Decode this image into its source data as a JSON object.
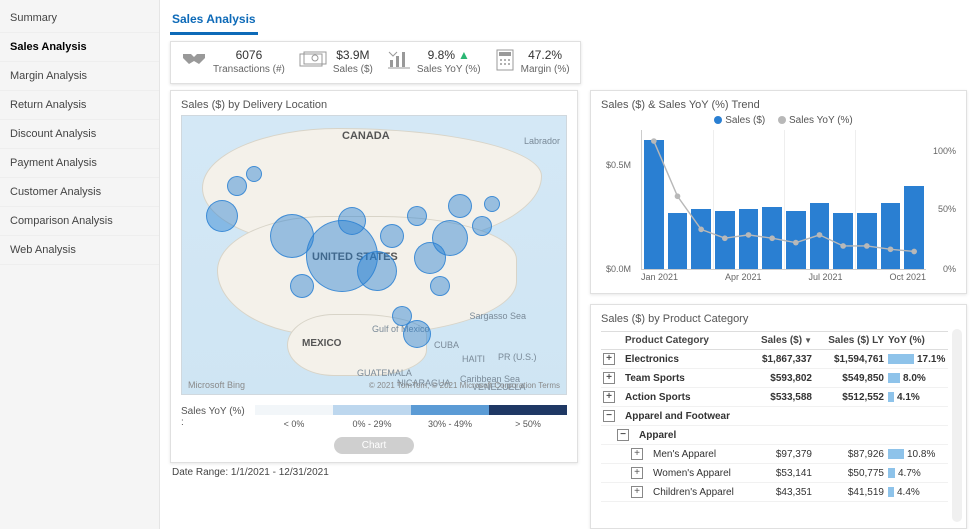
{
  "sidebar": {
    "items": [
      {
        "label": "Summary"
      },
      {
        "label": "Sales Analysis",
        "active": true
      },
      {
        "label": "Margin Analysis"
      },
      {
        "label": "Return Analysis"
      },
      {
        "label": "Discount Analysis"
      },
      {
        "label": "Payment Analysis"
      },
      {
        "label": "Customer Analysis"
      },
      {
        "label": "Comparison Analysis"
      },
      {
        "label": "Web Analysis"
      }
    ]
  },
  "header": {
    "tab_title": "Sales Analysis"
  },
  "kpis": [
    {
      "icon": "handshake",
      "value": "6076",
      "label": "Transactions (#)"
    },
    {
      "icon": "cash",
      "value": "$3.9M",
      "label": "Sales ($)"
    },
    {
      "icon": "barchart",
      "value": "9.8%",
      "trend": "up",
      "label": "Sales YoY (%)"
    },
    {
      "icon": "calculator",
      "value": "47.2%",
      "label": "Margin (%)"
    }
  ],
  "map": {
    "title": "Sales ($) by Delivery Location",
    "country_labels": [
      "CANADA",
      "UNITED STATES",
      "MEXICO"
    ],
    "sea_labels": [
      "Labrador",
      "Sargasso Sea",
      "Gulf of Mexico",
      "CUBA",
      "HAITI",
      "PR (U.S.)",
      "GUATEMALA",
      "NICARAGUA",
      "Caribbean Sea",
      "VENEZUELA"
    ],
    "attribution_left": "Microsoft Bing",
    "attribution_right": "© 2021 TomTom, © 2021 Microsoft Corporation   Terms",
    "legend_title": "Sales YoY (%) :",
    "legend_bins": [
      "< 0%",
      "0% - 29%",
      "30% - 49%",
      "> 50%"
    ],
    "chart_button": "Chart",
    "bubbles": [
      {
        "x": 40,
        "y": 100,
        "r": 16
      },
      {
        "x": 55,
        "y": 70,
        "r": 10
      },
      {
        "x": 72,
        "y": 58,
        "r": 8
      },
      {
        "x": 110,
        "y": 120,
        "r": 22
      },
      {
        "x": 160,
        "y": 140,
        "r": 36
      },
      {
        "x": 170,
        "y": 105,
        "r": 14
      },
      {
        "x": 195,
        "y": 155,
        "r": 20
      },
      {
        "x": 210,
        "y": 120,
        "r": 12
      },
      {
        "x": 235,
        "y": 100,
        "r": 10
      },
      {
        "x": 248,
        "y": 142,
        "r": 16
      },
      {
        "x": 258,
        "y": 170,
        "r": 10
      },
      {
        "x": 268,
        "y": 122,
        "r": 18
      },
      {
        "x": 278,
        "y": 90,
        "r": 12
      },
      {
        "x": 300,
        "y": 110,
        "r": 10
      },
      {
        "x": 310,
        "y": 88,
        "r": 8
      },
      {
        "x": 220,
        "y": 200,
        "r": 10
      },
      {
        "x": 235,
        "y": 218,
        "r": 14
      },
      {
        "x": 120,
        "y": 170,
        "r": 12
      }
    ]
  },
  "date_range_label": "Date Range: 1/1/2021 - 12/31/2021",
  "trend": {
    "title": "Sales ($) & Sales YoY (%) Trend",
    "legend": {
      "sales": "Sales ($)",
      "yoy": "Sales YoY (%)"
    },
    "axis_left": [
      "$0.5M",
      "$0.0M"
    ],
    "axis_right": [
      "100%",
      "50%",
      "0%"
    ],
    "axis_x": [
      "Jan 2021",
      "Apr 2021",
      "Jul 2021",
      "Oct 2021"
    ]
  },
  "chart_data": {
    "type": "combo",
    "title": "Sales ($) & Sales YoY (%) Trend",
    "x": [
      "Jan 2021",
      "Feb 2021",
      "Mar 2021",
      "Apr 2021",
      "May 2021",
      "Jun 2021",
      "Jul 2021",
      "Aug 2021",
      "Sep 2021",
      "Oct 2021",
      "Nov 2021",
      "Dec 2021"
    ],
    "series": [
      {
        "name": "Sales ($)",
        "kind": "bar",
        "y_axis": "left",
        "unit": "$",
        "values": [
          650000,
          280000,
          300000,
          290000,
          300000,
          310000,
          290000,
          330000,
          280000,
          280000,
          330000,
          420000
        ]
      },
      {
        "name": "Sales YoY (%)",
        "kind": "line",
        "y_axis": "right",
        "unit": "%",
        "values": [
          110,
          60,
          30,
          22,
          25,
          22,
          18,
          25,
          15,
          15,
          12,
          10
        ]
      }
    ],
    "y_axis_left": {
      "label": "Sales ($)",
      "min": 0,
      "max": 700000,
      "ticks": [
        0,
        500000
      ]
    },
    "y_axis_right": {
      "label": "Sales YoY (%)",
      "min": 0,
      "max": 120,
      "ticks": [
        0,
        50,
        100
      ]
    }
  },
  "table": {
    "title": "Sales ($) by Product Category",
    "columns": [
      "Product Category",
      "Sales ($)",
      "Sales ($) LY",
      "YoY (%)"
    ],
    "rows": [
      {
        "exp": "+",
        "indent": 0,
        "label": "Electronics",
        "sales": "$1,867,337",
        "ly": "$1,594,761",
        "yoy": "17.1%",
        "yoy_w": 26,
        "bold": true
      },
      {
        "exp": "+",
        "indent": 0,
        "label": "Team Sports",
        "sales": "$593,802",
        "ly": "$549,850",
        "yoy": "8.0%",
        "yoy_w": 12,
        "bold": true
      },
      {
        "exp": "+",
        "indent": 0,
        "label": "Action Sports",
        "sales": "$533,588",
        "ly": "$512,552",
        "yoy": "4.1%",
        "yoy_w": 6,
        "bold": true
      },
      {
        "exp": "−",
        "indent": 0,
        "label": "Apparel and Footwear",
        "bold": true
      },
      {
        "exp": "−",
        "indent": 1,
        "label": "Apparel",
        "bold": true
      },
      {
        "exp": "+",
        "indent": 2,
        "label": "Men's Apparel",
        "sales": "$97,379",
        "ly": "$87,926",
        "yoy": "10.8%",
        "yoy_w": 16
      },
      {
        "exp": "+",
        "indent": 2,
        "label": "Women's Apparel",
        "sales": "$53,141",
        "ly": "$50,775",
        "yoy": "4.7%",
        "yoy_w": 7
      },
      {
        "exp": "+",
        "indent": 2,
        "label": "Children's Apparel",
        "sales": "$43,351",
        "ly": "$41,519",
        "yoy": "4.4%",
        "yoy_w": 6
      }
    ]
  }
}
